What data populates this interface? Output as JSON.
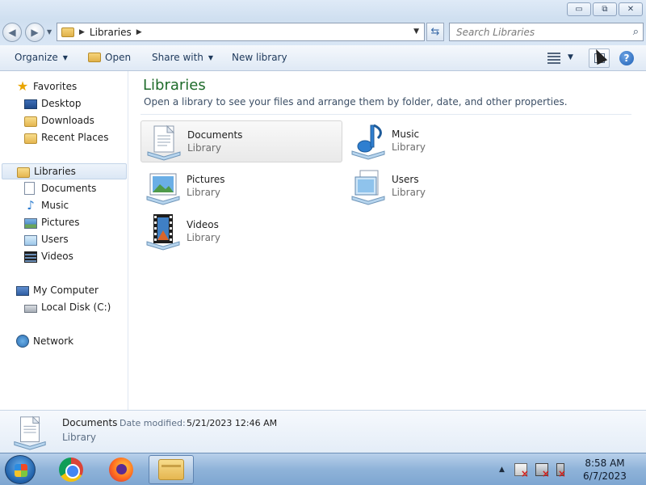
{
  "window": {
    "minimize_symbol": "▭",
    "maximize_symbol": "⧉",
    "close_symbol": "✕"
  },
  "navigation": {
    "back_symbol": "◀",
    "forward_symbol": "▶",
    "address_path": "Libraries",
    "search_placeholder": "Search Libraries"
  },
  "toolbar": {
    "organize": "Organize",
    "open": "Open",
    "share_with": "Share with",
    "new_library": "New library",
    "help_symbol": "?"
  },
  "sidebar": {
    "favorites": "Favorites",
    "desktop": "Desktop",
    "downloads": "Downloads",
    "recent_places": "Recent Places",
    "libraries": "Libraries",
    "documents": "Documents",
    "music": "Music",
    "pictures": "Pictures",
    "users": "Users",
    "videos": "Videos",
    "my_computer": "My Computer",
    "local_disk": "Local Disk (C:)",
    "network": "Network"
  },
  "main": {
    "title": "Libraries",
    "description": "Open a library to see your files and arrange them by folder, date, and other properties.",
    "items": [
      {
        "name": "Documents",
        "type": "Library",
        "icon": "documents-library-icon"
      },
      {
        "name": "Music",
        "type": "Library",
        "icon": "music-library-icon"
      },
      {
        "name": "Pictures",
        "type": "Library",
        "icon": "pictures-library-icon"
      },
      {
        "name": "Users",
        "type": "Library",
        "icon": "users-library-icon"
      },
      {
        "name": "Videos",
        "type": "Library",
        "icon": "videos-library-icon"
      }
    ]
  },
  "details": {
    "name": "Documents",
    "date_label": "Date modified:",
    "date_value": "5/21/2023 12:46 AM",
    "type": "Library"
  },
  "taskbar": {
    "time": "8:58 AM",
    "date": "6/7/2023"
  },
  "colors": {
    "title_green": "#1e6b2a",
    "toolbar_text": "#1e395b",
    "taskbar_blue": "#8fb3d9"
  }
}
